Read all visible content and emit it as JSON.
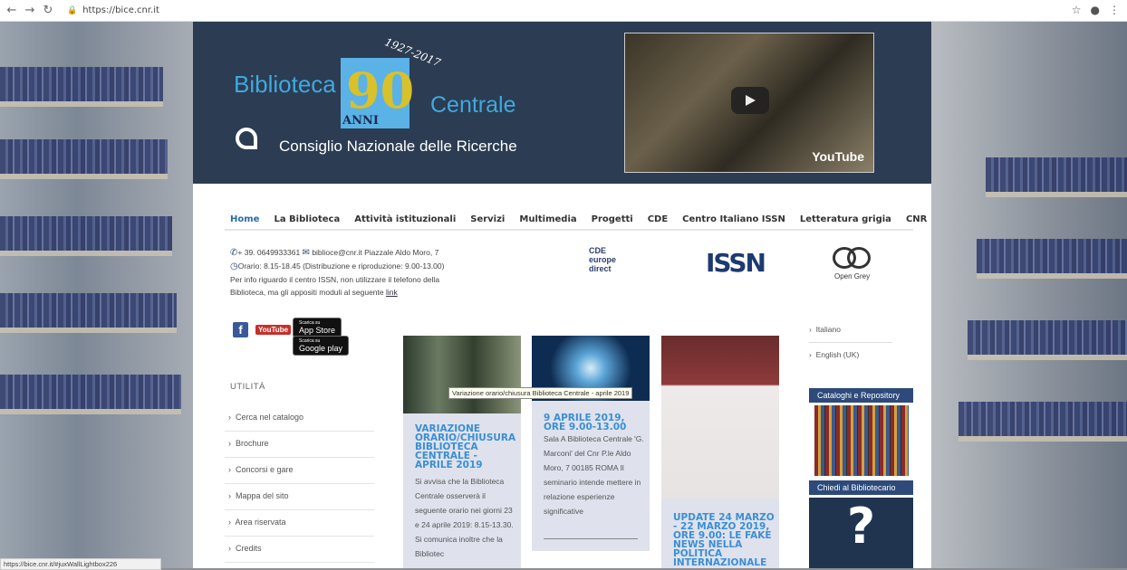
{
  "browser": {
    "url": "https://bice.cnr.it"
  },
  "header": {
    "logo_left": "Biblioteca",
    "logo_number": "90",
    "logo_anni": "ANNI",
    "logo_years": "1927-2017",
    "logo_right": "Centrale",
    "org": "Consiglio Nazionale delle Ricerche",
    "youtube": "YouTube"
  },
  "menu": [
    "Home",
    "La Biblioteca",
    "Attività istituzionali",
    "Servizi",
    "Multimedia",
    "Progetti",
    "CDE",
    "Centro Italiano ISSN",
    "Letteratura grigia",
    "CNR"
  ],
  "contact": {
    "phone": "+ 39. 0649933361",
    "email": "biblioce@cnr.it",
    "address": "Piazzale Aldo Moro, 7",
    "hours": "Orario: 8.15-18.45 (Distribuzione e riproduzione: 9.00-13.00)",
    "issn_note": "Per info riguardo il centro ISSN, non utilizzare il telefono della Biblioteca, ma gli appositi moduli al seguente",
    "link": "link"
  },
  "partners": {
    "cde": "CDE europe direct",
    "issn": "ISSN",
    "opengrey": "Open Grey"
  },
  "social": {
    "facebook": "f",
    "youtube": "YouTube",
    "appstore_small": "Scarica su",
    "appstore": "App Store",
    "gplay_small": "Scarica su",
    "gplay": "Google play"
  },
  "sidebar": {
    "title": "UTILITÀ",
    "items": [
      "Cerca nel catalogo",
      "Brochure",
      "Concorsi e gare",
      "Mappa del sito",
      "Area riservata",
      "Credits"
    ]
  },
  "cards": [
    {
      "title": "VARIAZIONE ORARIO/CHIUSURA BIBLIOTECA CENTRALE - APRILE 2019",
      "text": "Si avvisa che la Biblioteca Centrale osserverà il seguente orario nei giorni 23 e 24 aprile 2019: 8.15-13.30. Si comunica inoltre che la Bibliotec"
    },
    {
      "title": "9 APRILE 2019, ORE 9.00-13.00",
      "text": "Sala A Biblioteca Centrale 'G. Marconi' del Cnr P.le Aldo Moro, 7 00185 ROMA Il seminario intende mettere in relazione esperienze significative"
    },
    {
      "title": "UPDATE 24 MARZO - 22 MARZO 2019, ORE 9.00: LE FAKE NEWS NELLA POLITICA INTERNAZIONALE"
    }
  ],
  "tooltip": "Variazione orario/chiusura Biblioteca Centrale - aprile 2019",
  "languages": [
    "Italiano",
    "English (UK)"
  ],
  "right_banners": [
    "Cataloghi e Repository",
    "Chiedi al Bibliotecario"
  ],
  "status_url": "https://bice.cnr.it/#juxWallLightbox226"
}
